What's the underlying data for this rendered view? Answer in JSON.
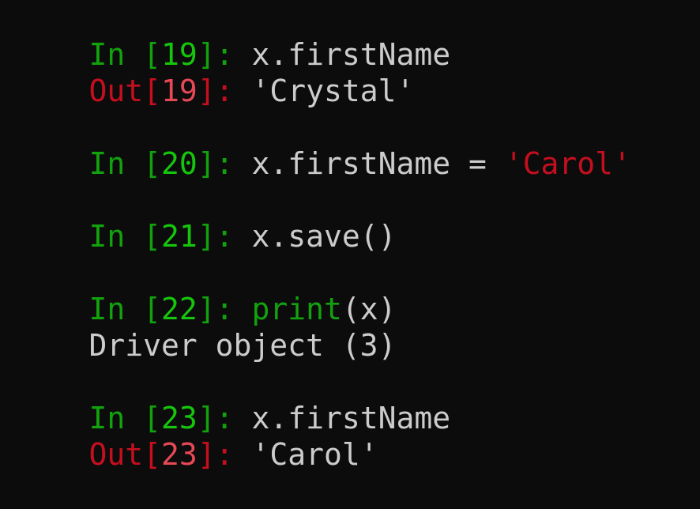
{
  "colors": {
    "background": "#0c0c0c",
    "in_prompt": "#13a10e",
    "in_number": "#16c60c",
    "out_prompt": "#c50f1f",
    "out_number": "#e74856",
    "text": "#cccccc",
    "string": "#c50f1f"
  },
  "cells": [
    {
      "in_label": "In ",
      "in_open": "[",
      "in_num": "19",
      "in_close": "]",
      "in_colon": ": ",
      "code": "x.firstName",
      "out_label": "Out",
      "out_open": "[",
      "out_num": "19",
      "out_close": "]",
      "out_colon": ": ",
      "out_value": "'Crystal'"
    },
    {
      "in_label": "In ",
      "in_open": "[",
      "in_num": "20",
      "in_close": "]",
      "in_colon": ": ",
      "code_prefix": "x.firstName = ",
      "code_string": "'Carol'"
    },
    {
      "in_label": "In ",
      "in_open": "[",
      "in_num": "21",
      "in_close": "]",
      "in_colon": ": ",
      "code": "x.save()"
    },
    {
      "in_label": "In ",
      "in_open": "[",
      "in_num": "22",
      "in_close": "]",
      "in_colon": ": ",
      "code_builtin": "print",
      "code_args": "(x)",
      "stdout": "Driver object (3)"
    },
    {
      "in_label": "In ",
      "in_open": "[",
      "in_num": "23",
      "in_close": "]",
      "in_colon": ": ",
      "code": "x.firstName",
      "out_label": "Out",
      "out_open": "[",
      "out_num": "23",
      "out_close": "]",
      "out_colon": ": ",
      "out_value": "'Carol'"
    }
  ]
}
